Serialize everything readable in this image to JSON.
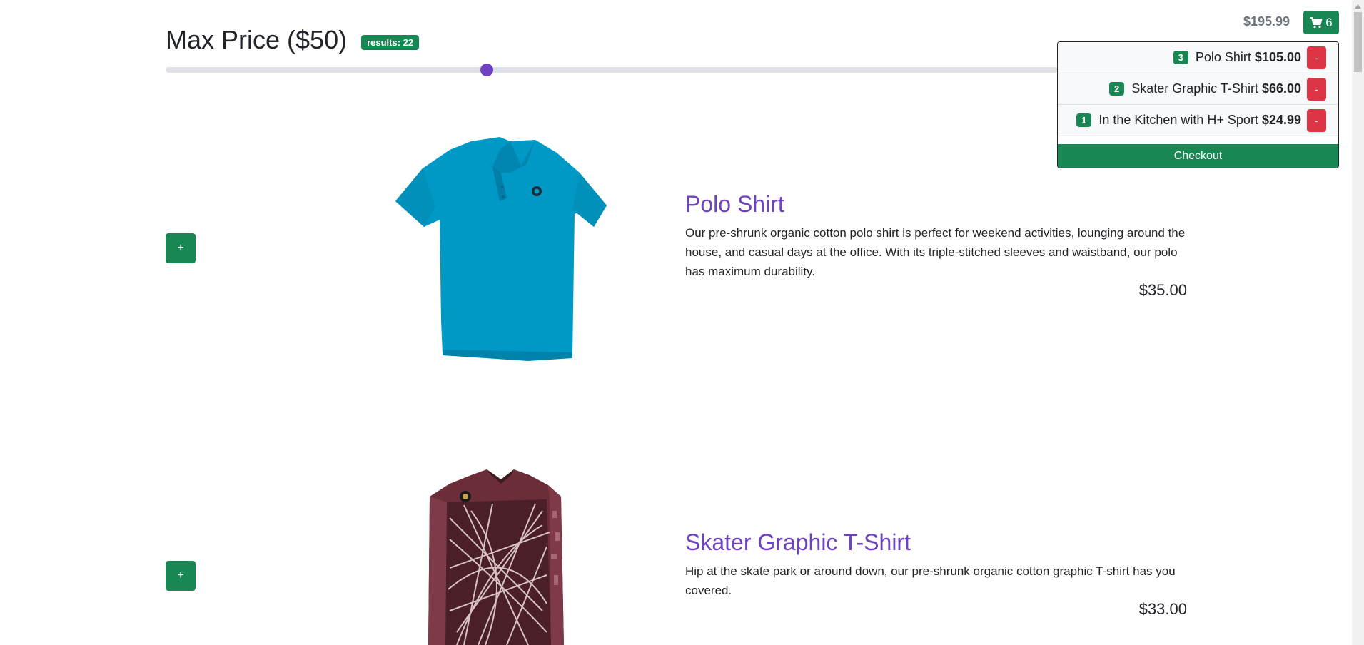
{
  "filter": {
    "title": "Max Price ($50)",
    "results_badge": "results: 22",
    "slider_value_fraction": 0.36
  },
  "cart": {
    "total": "$195.99",
    "count": "6",
    "items": [
      {
        "qty": "3",
        "name": "Polo Shirt",
        "price": "$105.00",
        "remove_label": "-"
      },
      {
        "qty": "2",
        "name": "Skater Graphic T-Shirt",
        "price": "$66.00",
        "remove_label": "-"
      },
      {
        "qty": "1",
        "name": "In the Kitchen with H+ Sport",
        "price": "$24.99",
        "remove_label": "-"
      }
    ],
    "checkout_label": "Checkout"
  },
  "products": [
    {
      "add_label": "+",
      "name": "Polo Shirt",
      "description": "Our pre-shrunk organic cotton polo shirt is perfect for weekend activities, lounging around the house, and casual days at the office. With its triple-stitched sleeves and waistband, our polo has maximum durability.",
      "price": "$35.00"
    },
    {
      "add_label": "+",
      "name": "Skater Graphic T-Shirt",
      "description": "Hip at the skate park or around down, our pre-shrunk organic cotton graphic T-shirt has you covered.",
      "price": "$33.00"
    }
  ],
  "colors": {
    "success": "#198754",
    "danger": "#dc3545",
    "accent": "#6f42c1",
    "polo": "#0099c6",
    "skater": "#6b2d38"
  },
  "icons": {
    "cart": "shopping-cart-icon",
    "scroll_up": "arrow-up-icon"
  }
}
